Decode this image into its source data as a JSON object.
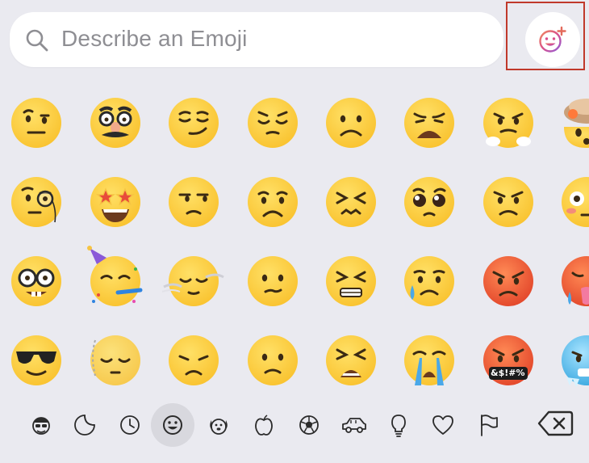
{
  "search": {
    "placeholder": "Describe an Emoji"
  },
  "genmoji_button": {
    "icon": "genmoji-create-icon",
    "highlight_color": "#c0392b"
  },
  "emoji_grid": {
    "rows": [
      [
        "neutral-face-raised-eyebrow",
        "disguised-face",
        "smirking-face",
        "pensive-face",
        "frowning-face",
        "weary-face",
        "steam-from-nose-face",
        "exploding-head"
      ],
      [
        "monocle-face",
        "star-struck",
        "unamused-face",
        "worried-face",
        "confounded-face",
        "pleading-face",
        "angry-face",
        "flushed-face"
      ],
      [
        "nerd-face",
        "partying-face",
        "face-in-clouds",
        "confused-face",
        "persevering-face",
        "sad-but-relieved-face",
        "pouting-face",
        "hot-face"
      ],
      [
        "sunglasses-face",
        "dotted-line-face",
        "disappointed-face",
        "slightly-frowning-face",
        "tired-face",
        "loudly-crying-face",
        "cursing-face",
        "cold-face"
      ]
    ],
    "cursing_symbols": "&$!#%"
  },
  "categories": [
    {
      "name": "memoji-icon"
    },
    {
      "name": "stickers-icon"
    },
    {
      "name": "recent-clock-icon"
    },
    {
      "name": "smileys-icon",
      "active": true
    },
    {
      "name": "animals-icon"
    },
    {
      "name": "food-apple-icon"
    },
    {
      "name": "activity-soccer-icon"
    },
    {
      "name": "travel-car-icon"
    },
    {
      "name": "objects-lightbulb-icon"
    },
    {
      "name": "symbols-heart-icon"
    },
    {
      "name": "flags-icon"
    }
  ],
  "delete_key": {
    "icon": "delete-backspace-icon"
  },
  "colors": {
    "background": "#eaeaf0",
    "emoji_yellow": "#f9c22e",
    "angry_red": "#ef5a2f",
    "cold_blue": "#6ac4ef"
  }
}
